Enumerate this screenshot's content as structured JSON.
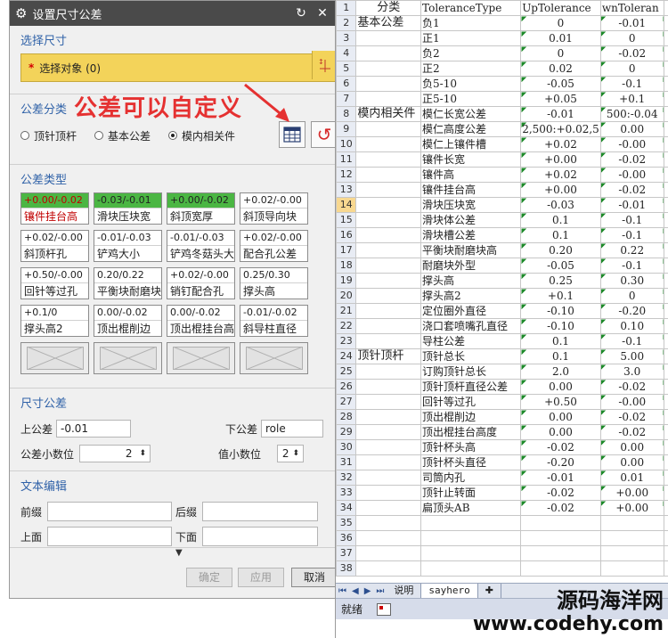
{
  "dialog": {
    "title": "设置尺寸公差",
    "section_select": {
      "title": "选择尺寸",
      "star": "*",
      "label": "选择对象 (0)"
    },
    "section_category": {
      "title": "公差分类",
      "annotation": "公差可以自定义",
      "options": [
        {
          "label": "顶针顶杆",
          "checked": false
        },
        {
          "label": "基本公差",
          "checked": false
        },
        {
          "label": "模内相关件",
          "checked": true
        }
      ]
    },
    "section_type": {
      "title": "公差类型",
      "cells": [
        {
          "value": "+0.00/-0.02",
          "name": "镶件挂台高",
          "style": "green-red"
        },
        {
          "value": "-0.03/-0.01",
          "name": "滑块压块宽",
          "style": "green"
        },
        {
          "value": "+0.00/-0.02",
          "name": "斜顶宽厚",
          "style": "green"
        },
        {
          "value": "+0.02/-0.00",
          "name": "斜顶导向块",
          "style": ""
        },
        {
          "value": "+0.02/-0.00",
          "name": "斜顶杆孔",
          "style": ""
        },
        {
          "value": "-0.01/-0.03",
          "name": "铲鸡大小",
          "style": ""
        },
        {
          "value": "-0.01/-0.03",
          "name": "铲鸡冬菇头大",
          "style": ""
        },
        {
          "value": "+0.02/-0.00",
          "name": "配合孔公差",
          "style": ""
        },
        {
          "value": "+0.50/-0.00",
          "name": "回针等过孔",
          "style": ""
        },
        {
          "value": "0.20/0.22",
          "name": "平衡块耐磨块",
          "style": ""
        },
        {
          "value": "+0.02/-0.00",
          "name": "销钉配合孔",
          "style": ""
        },
        {
          "value": "0.25/0.30",
          "name": "撑头高",
          "style": ""
        },
        {
          "value": "+0.1/0",
          "name": "撑头高2",
          "style": ""
        },
        {
          "value": "0.00/-0.02",
          "name": "顶出棍削边",
          "style": ""
        },
        {
          "value": "0.00/-0.02",
          "name": "顶出棍挂台高",
          "style": ""
        },
        {
          "value": "-0.01/-0.02",
          "name": "斜导柱直径",
          "style": ""
        }
      ]
    },
    "section_dim": {
      "title": "尺寸公差",
      "upper_label": "上公差",
      "upper_value": "-0.01",
      "lower_label": "下公差",
      "lower_value": "role",
      "tol_decimals_label": "公差小数位",
      "tol_decimals_value": "2",
      "val_decimals_label": "值小数位",
      "val_decimals_value": "2"
    },
    "section_text": {
      "title": "文本编辑",
      "prefix_label": "前缀",
      "suffix_label": "后缀",
      "above_label": "上面",
      "below_label": "下面"
    },
    "buttons": {
      "ok": "确定",
      "apply": "应用",
      "cancel": "取消"
    }
  },
  "sheet": {
    "headers": [
      "分类",
      "ToleranceType",
      "UpTolerance",
      "wnToleran"
    ],
    "rows": [
      [
        "基本公差",
        "负1",
        "0",
        "-0.01"
      ],
      [
        "",
        "正1",
        "0.01",
        "0"
      ],
      [
        "",
        "负2",
        "0",
        "-0.02"
      ],
      [
        "",
        "正2",
        "0.02",
        "0"
      ],
      [
        "",
        "负5-10",
        "-0.05",
        "-0.1"
      ],
      [
        "",
        "正5-10",
        "+0.05",
        "+0.1"
      ],
      [
        "模内相关件",
        "模仁长宽公差",
        "-0.01",
        "500:-0.04"
      ],
      [
        "",
        "模仁高度公差",
        "2,500:+0.02,5",
        "0.00"
      ],
      [
        "",
        "模仁上镶件槽",
        "+0.02",
        "-0.00"
      ],
      [
        "",
        "镶件长宽",
        "+0.00",
        "-0.02"
      ],
      [
        "",
        "镶件高",
        "+0.02",
        "-0.00"
      ],
      [
        "",
        "镶件挂台高",
        "+0.00",
        "-0.02"
      ],
      [
        "",
        "滑块压块宽",
        "-0.03",
        "-0.01"
      ],
      [
        "",
        "滑块体公差",
        "0.1",
        "-0.1"
      ],
      [
        "",
        "滑块槽公差",
        "0.1",
        "-0.1"
      ],
      [
        "",
        "平衡块耐磨块高",
        "0.20",
        "0.22"
      ],
      [
        "",
        "耐磨块外型",
        "-0.05",
        "-0.1"
      ],
      [
        "",
        "撑头高",
        "0.25",
        "0.30"
      ],
      [
        "",
        "撑头高2",
        "+0.1",
        "0"
      ],
      [
        "",
        "定位圈外直径",
        "-0.10",
        "-0.20"
      ],
      [
        "",
        "浇口套喷嘴孔直径",
        "-0.10",
        "0.10"
      ],
      [
        "",
        "导柱公差",
        "0.1",
        "-0.1"
      ],
      [
        "顶针顶杆",
        "顶针总长",
        "0.1",
        "5.00"
      ],
      [
        "",
        "订购顶针总长",
        "2.0",
        "3.0"
      ],
      [
        "",
        "顶针顶杆直径公差",
        "0.00",
        "-0.02"
      ],
      [
        "",
        "回针等过孔",
        "+0.50",
        "-0.00"
      ],
      [
        "",
        "顶出棍削边",
        "0.00",
        "-0.02"
      ],
      [
        "",
        "顶出棍挂台高度",
        "0.00",
        "-0.02"
      ],
      [
        "",
        "顶针杯头高",
        "-0.02",
        "0.00"
      ],
      [
        "",
        "顶针杯头直径",
        "-0.20",
        "0.00"
      ],
      [
        "",
        "司筒内孔",
        "-0.01",
        "0.01"
      ],
      [
        "",
        "顶针止转面",
        "-0.02",
        "+0.00"
      ],
      [
        "",
        "扁顶头AB",
        "-0.02",
        "+0.00"
      ]
    ],
    "row_numbers": [
      "1",
      "2",
      "3",
      "4",
      "5",
      "6",
      "7",
      "8",
      "9",
      "10",
      "11",
      "12",
      "13",
      "14",
      "15",
      "16",
      "17",
      "18",
      "19",
      "20",
      "21",
      "22",
      "23",
      "24",
      "25",
      "26",
      "27",
      "28",
      "29",
      "30",
      "31",
      "32",
      "33",
      "34",
      "35",
      "36",
      "37",
      "38"
    ],
    "tabs": [
      "说明",
      "sayhero"
    ],
    "status": "就绪",
    "watermark1": "源码海洋网",
    "watermark2": "www.codehy.com"
  }
}
